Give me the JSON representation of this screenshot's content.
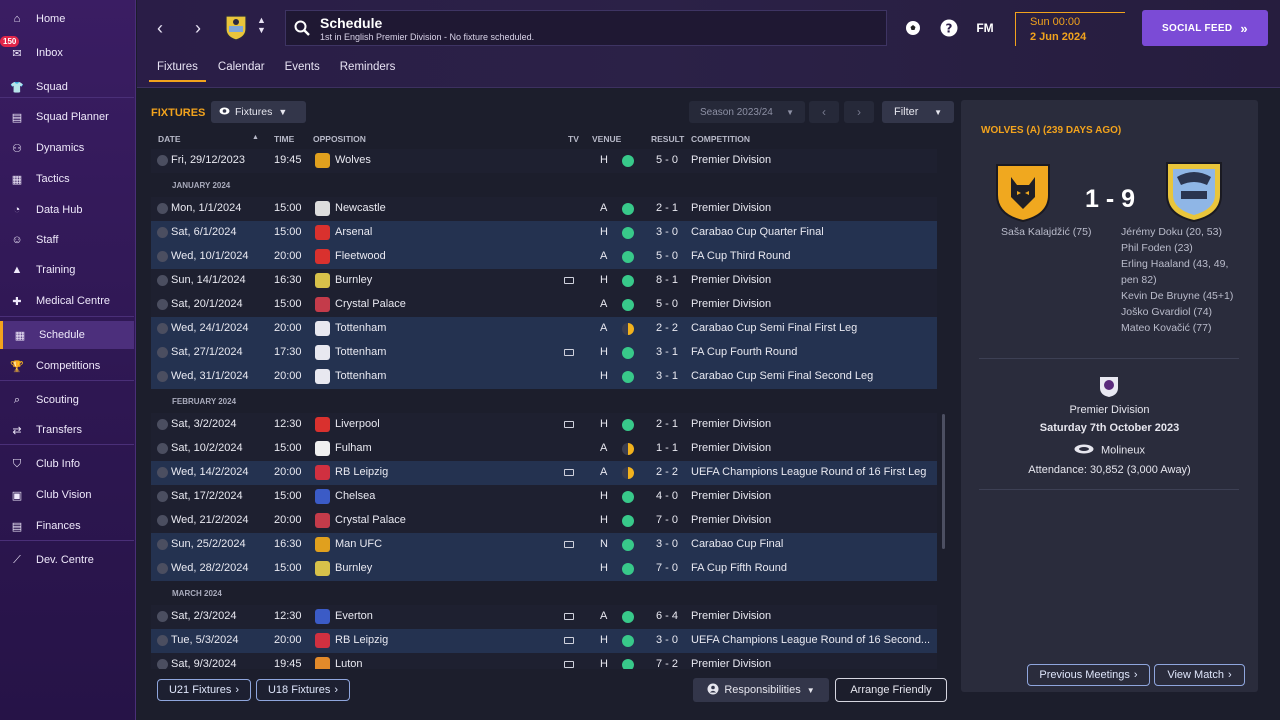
{
  "sidebar": {
    "items": [
      {
        "label": "Home",
        "icon": "home-icon"
      },
      {
        "label": "Inbox",
        "icon": "inbox-icon",
        "badge": "150"
      },
      {
        "label": "Squad",
        "icon": "squad-icon"
      },
      {
        "label": "Squad Planner",
        "icon": "clipboard-icon"
      },
      {
        "label": "Dynamics",
        "icon": "dynamics-icon"
      },
      {
        "label": "Tactics",
        "icon": "tactics-icon"
      },
      {
        "label": "Data Hub",
        "icon": "data-hub-icon"
      },
      {
        "label": "Staff",
        "icon": "staff-icon"
      },
      {
        "label": "Training",
        "icon": "training-icon"
      },
      {
        "label": "Medical Centre",
        "icon": "medical-icon"
      },
      {
        "label": "Schedule",
        "icon": "calendar-icon"
      },
      {
        "label": "Competitions",
        "icon": "trophy-icon"
      },
      {
        "label": "Scouting",
        "icon": "scouting-icon"
      },
      {
        "label": "Transfers",
        "icon": "transfers-icon"
      },
      {
        "label": "Club Info",
        "icon": "shield-icon"
      },
      {
        "label": "Club Vision",
        "icon": "briefcase-icon"
      },
      {
        "label": "Finances",
        "icon": "finances-icon"
      },
      {
        "label": "Dev. Centre",
        "icon": "dev-centre-icon"
      }
    ],
    "active": "Schedule"
  },
  "header": {
    "title": "Schedule",
    "subtitle": "1st in English Premier Division - No fixture scheduled.",
    "fm_label": "FM",
    "time": "Sun 00:00",
    "date": "2 Jun 2024",
    "social_feed": "SOCIAL FEED",
    "tabs": [
      "Fixtures",
      "Calendar",
      "Events",
      "Reminders"
    ],
    "active_tab": "Fixtures"
  },
  "fixtures": {
    "label": "FIXTURES",
    "view_dropdown": "Fixtures",
    "season": "Season 2023/24",
    "filter": "Filter",
    "columns": {
      "date": "DATE",
      "time": "TIME",
      "opposition": "OPPOSITION",
      "tv": "TV",
      "venue": "VENUE",
      "result": "RESULT",
      "competition": "COMPETITION"
    },
    "rows": [
      {
        "date": "Fri, 29/12/2023",
        "time": "19:45",
        "opp": "Wolves",
        "tv": false,
        "venue": "H",
        "res": "win",
        "score": "5 - 0",
        "comp": "Premier Division",
        "cup": false,
        "color": "#e0a01e"
      },
      {
        "month": "JANUARY 2024"
      },
      {
        "date": "Mon, 1/1/2024",
        "time": "15:00",
        "opp": "Newcastle",
        "tv": false,
        "venue": "A",
        "res": "win",
        "score": "2 - 1",
        "comp": "Premier Division",
        "cup": false,
        "color": "#dddddd"
      },
      {
        "date": "Sat, 6/1/2024",
        "time": "15:00",
        "opp": "Arsenal",
        "tv": false,
        "venue": "H",
        "res": "win",
        "score": "3 - 0",
        "comp": "Carabao Cup Quarter Final",
        "cup": true,
        "color": "#d9312e"
      },
      {
        "date": "Wed, 10/1/2024",
        "time": "20:00",
        "opp": "Fleetwood",
        "tv": false,
        "venue": "A",
        "res": "win",
        "score": "5 - 0",
        "comp": "FA Cup Third Round",
        "cup": true,
        "color": "#d9312e"
      },
      {
        "date": "Sun, 14/1/2024",
        "time": "16:30",
        "opp": "Burnley",
        "tv": true,
        "venue": "H",
        "res": "win",
        "score": "8 - 1",
        "comp": "Premier Division",
        "cup": false,
        "color": "#d7c14a"
      },
      {
        "date": "Sat, 20/1/2024",
        "time": "15:00",
        "opp": "Crystal Palace",
        "tv": false,
        "venue": "A",
        "res": "win",
        "score": "5 - 0",
        "comp": "Premier Division",
        "cup": false,
        "color": "#c43b4a"
      },
      {
        "date": "Wed, 24/1/2024",
        "time": "20:00",
        "opp": "Tottenham",
        "tv": false,
        "venue": "A",
        "res": "draw",
        "score": "2 - 2",
        "comp": "Carabao Cup Semi Final First Leg",
        "cup": true,
        "color": "#e8e8f0"
      },
      {
        "date": "Sat, 27/1/2024",
        "time": "17:30",
        "opp": "Tottenham",
        "tv": true,
        "venue": "H",
        "res": "win",
        "score": "3 - 1",
        "comp": "FA Cup Fourth Round",
        "cup": true,
        "color": "#e8e8f0"
      },
      {
        "date": "Wed, 31/1/2024",
        "time": "20:00",
        "opp": "Tottenham",
        "tv": false,
        "venue": "H",
        "res": "win",
        "score": "3 - 1",
        "comp": "Carabao Cup Semi Final Second Leg",
        "cup": true,
        "color": "#e8e8f0"
      },
      {
        "month": "FEBRUARY 2024"
      },
      {
        "date": "Sat, 3/2/2024",
        "time": "12:30",
        "opp": "Liverpool",
        "tv": true,
        "venue": "H",
        "res": "win",
        "score": "2 - 1",
        "comp": "Premier Division",
        "cup": false,
        "color": "#d9312e"
      },
      {
        "date": "Sat, 10/2/2024",
        "time": "15:00",
        "opp": "Fulham",
        "tv": false,
        "venue": "A",
        "res": "draw",
        "score": "1 - 1",
        "comp": "Premier Division",
        "cup": false,
        "color": "#f0f0f0"
      },
      {
        "date": "Wed, 14/2/2024",
        "time": "20:00",
        "opp": "RB Leipzig",
        "tv": true,
        "venue": "A",
        "res": "draw",
        "score": "2 - 2",
        "comp": "UEFA Champions League Round of 16  First Leg",
        "cup": true,
        "color": "#d03040"
      },
      {
        "date": "Sat, 17/2/2024",
        "time": "15:00",
        "opp": "Chelsea",
        "tv": false,
        "venue": "H",
        "res": "win",
        "score": "4 - 0",
        "comp": "Premier Division",
        "cup": false,
        "color": "#3b5bc6"
      },
      {
        "date": "Wed, 21/2/2024",
        "time": "20:00",
        "opp": "Crystal Palace",
        "tv": false,
        "venue": "H",
        "res": "win",
        "score": "7 - 0",
        "comp": "Premier Division",
        "cup": false,
        "color": "#c43b4a"
      },
      {
        "date": "Sun, 25/2/2024",
        "time": "16:30",
        "opp": "Man UFC",
        "tv": true,
        "venue": "N",
        "res": "win",
        "score": "3 - 0",
        "comp": "Carabao Cup Final",
        "cup": true,
        "color": "#e0a01e"
      },
      {
        "date": "Wed, 28/2/2024",
        "time": "15:00",
        "opp": "Burnley",
        "tv": false,
        "venue": "H",
        "res": "win",
        "score": "7 - 0",
        "comp": "FA Cup Fifth Round",
        "cup": true,
        "color": "#d7c14a"
      },
      {
        "month": "MARCH 2024"
      },
      {
        "date": "Sat, 2/3/2024",
        "time": "12:30",
        "opp": "Everton",
        "tv": true,
        "venue": "A",
        "res": "win",
        "score": "6 - 4",
        "comp": "Premier Division",
        "cup": false,
        "color": "#3b5bc6"
      },
      {
        "date": "Tue, 5/3/2024",
        "time": "20:00",
        "opp": "RB Leipzig",
        "tv": true,
        "venue": "H",
        "res": "win",
        "score": "3 - 0",
        "comp": "UEFA Champions League Round of 16  Second...",
        "cup": true,
        "color": "#d03040"
      },
      {
        "date": "Sat, 9/3/2024",
        "time": "19:45",
        "opp": "Luton",
        "tv": true,
        "venue": "H",
        "res": "win",
        "score": "7 - 2",
        "comp": "Premier Division",
        "cup": false,
        "color": "#e38a2a"
      }
    ],
    "u21": "U21 Fixtures",
    "u18": "U18 Fixtures",
    "responsibilities": "Responsibilities",
    "arrange_friendly": "Arrange Friendly"
  },
  "match_panel": {
    "title": "WOLVES (A) (239 DAYS AGO)",
    "score": "1 - 9",
    "home_scorers": [
      "Saša Kalajdžić (75)"
    ],
    "away_scorers": [
      "Jérémy Doku (20, 53)",
      "Phil Foden (23)",
      "Erling Haaland (43, 49,",
      "pen 82)",
      "Kevin De Bruyne (45+1)",
      "Joško Gvardiol (74)",
      "Mateo Kovačić (77)"
    ],
    "competition": "Premier Division",
    "date": "Saturday 7th October 2023",
    "stadium": "Molineux",
    "attendance": "Attendance: 30,852 (3,000 Away)",
    "previous_meetings": "Previous Meetings",
    "view_match": "View Match"
  },
  "colors": {
    "accent": "#f2a31d",
    "win": "#38c98a",
    "draw": "#f2b21d",
    "social": "#7b4bd6"
  }
}
